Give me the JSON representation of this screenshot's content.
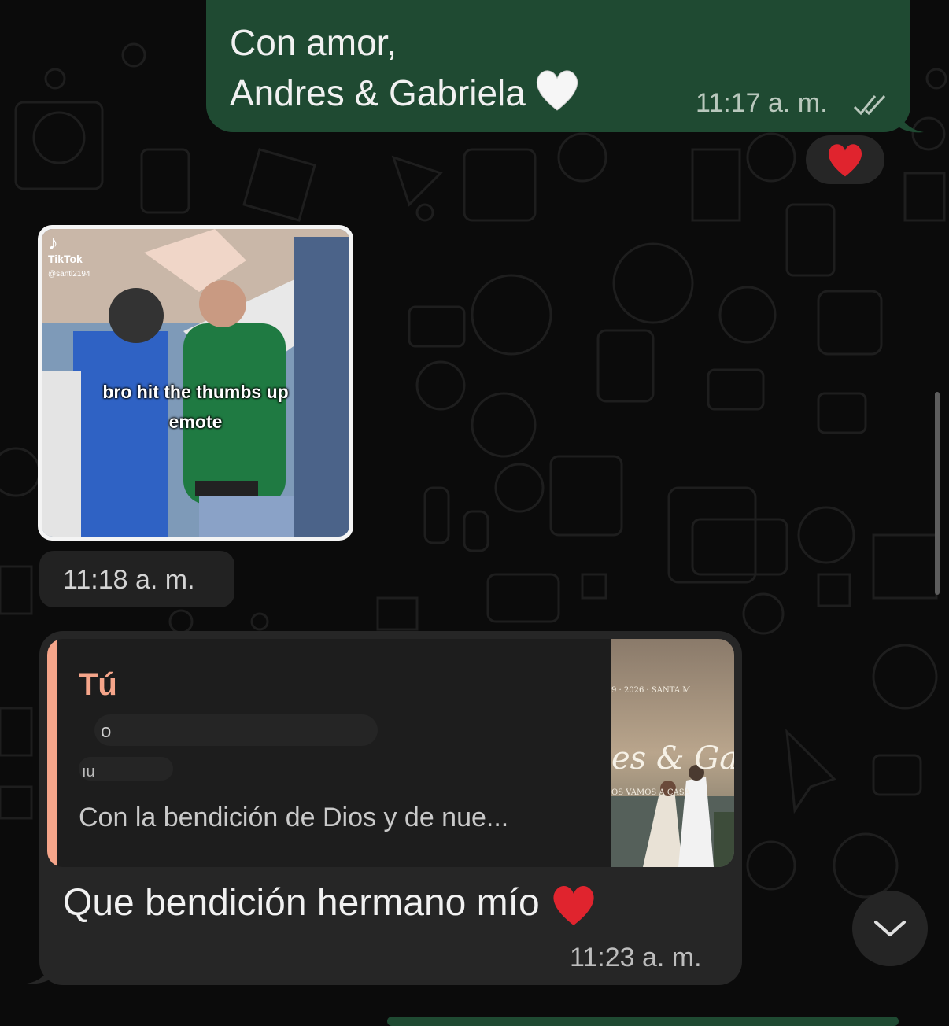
{
  "chat": {
    "outgoing_message": {
      "text": "Con amor,\nAndres & Gabriela",
      "emoji": "white-heart",
      "time": "11:17 a. m.",
      "status": "read-double-check",
      "reaction": "❤️"
    },
    "media_message": {
      "watermark_brand": "TikTok",
      "watermark_user": "@santi2194",
      "caption": "bro hit the thumbs up\nemote",
      "time": "11:18 a. m."
    },
    "reply_message": {
      "quoted_author": "Tú",
      "quoted_fragment_1": "o",
      "quoted_fragment_2": "ıu",
      "quoted_text": "Con la bendición de Dios y de nue...",
      "thumbnail_date": "9 · 2026  ·  SANTA M",
      "thumbnail_names": "es & Ga",
      "thumbnail_sub": "OS VAMOS A CASA",
      "text": "Que bendición hermano mío",
      "emoji": "❤️",
      "time": "11:23 a. m."
    }
  },
  "colors": {
    "outgoing_bubble": "#1f4a32",
    "incoming_bubble": "#262626",
    "quote_accent": "#f5a58a",
    "background": "#0b0b0b"
  },
  "icons": {
    "scroll_down": "chevron-down-icon",
    "read_receipt": "double-check-icon"
  }
}
